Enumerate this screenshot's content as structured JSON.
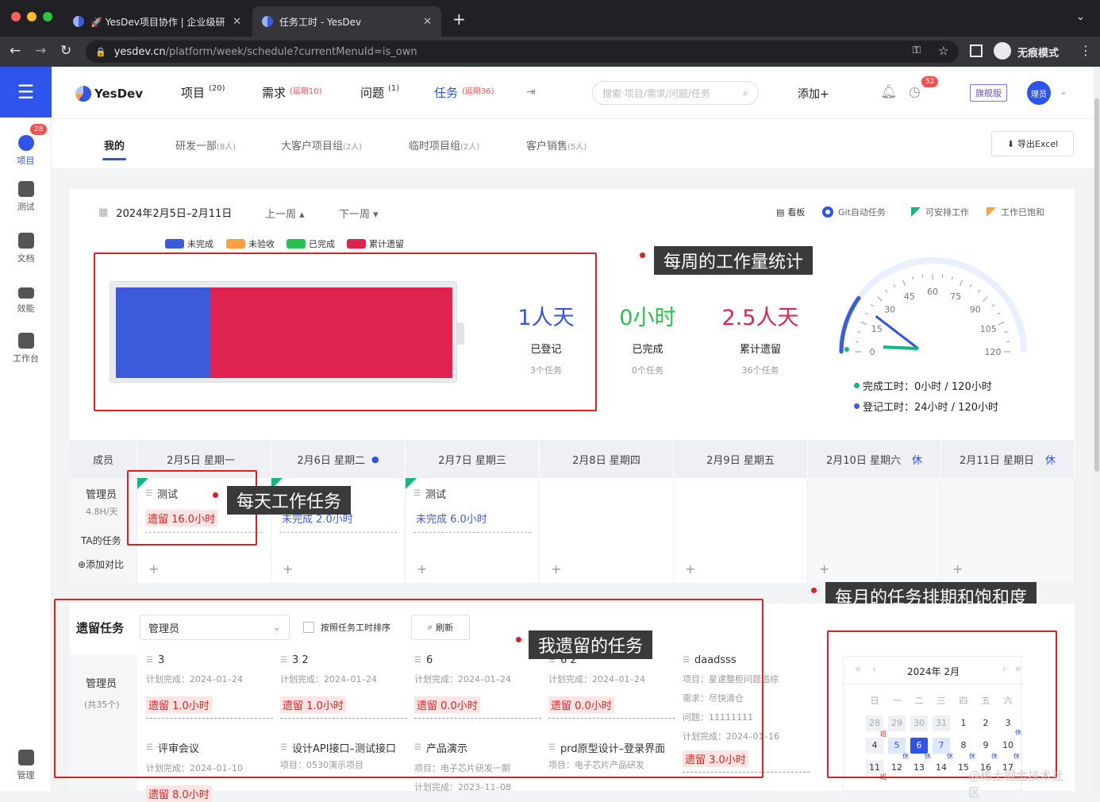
{
  "browser": {
    "tabs": [
      {
        "label": "🚀 YesDev项目协作 | 企业级研发"
      },
      {
        "label": "任务工时 - YesDev"
      }
    ],
    "url_host": "yesdev.cn",
    "url_path": "/platform/week/schedule?currentMenuId=is_own",
    "incognito_label": "无痕模式",
    "new_tab": "+"
  },
  "sidebar": {
    "items": [
      {
        "label": "项目",
        "badge": "28"
      },
      {
        "label": "测试"
      },
      {
        "label": "文档"
      },
      {
        "label": "效能"
      },
      {
        "label": "工作台"
      }
    ],
    "bottom": {
      "label": "管理"
    }
  },
  "header": {
    "logo": "YesDev",
    "nav": [
      {
        "label": "项目",
        "sup": "(20)"
      },
      {
        "label": "需求",
        "sup": "(延期10)"
      },
      {
        "label": "问题",
        "sup": "(1)"
      },
      {
        "label": "任务",
        "sup": "(延期36)"
      }
    ],
    "search_placeholder": "搜索 项目/需求/问题/任务",
    "add": "添加+",
    "notif_badge": "52",
    "edition": "旗舰版",
    "avatar": "理员"
  },
  "subnav": {
    "tabs": [
      {
        "label": "我的",
        "count": ""
      },
      {
        "label": "研发一部",
        "count": "(8人)"
      },
      {
        "label": "大客户项目组",
        "count": "(2人)"
      },
      {
        "label": "临时项目组",
        "count": "(2人)"
      },
      {
        "label": "客户销售",
        "count": "(5人)"
      }
    ],
    "export": "导出Excel"
  },
  "week": {
    "range": "2024年2月5日–2月11日",
    "prev": "上一周",
    "next": "下一周",
    "tools": [
      "看板",
      "Git自动任务",
      "可安排工作",
      "工作已饱和"
    ],
    "legend": [
      {
        "label": "未完成",
        "color": "#3b5bdb"
      },
      {
        "label": "未验收",
        "color": "#ff9f43"
      },
      {
        "label": "已完成",
        "color": "#27c24c"
      },
      {
        "label": "累计遗留",
        "color": "#e0234e"
      }
    ],
    "battery_fraction": {
      "incomplete": 0.28,
      "remain": 0.72
    },
    "stats": [
      {
        "value": "1人天",
        "label": "已登记",
        "sub": "3个任务",
        "color": "#2f54eb"
      },
      {
        "value": "0小时",
        "label": "已完成",
        "sub": "0个任务",
        "color": "#27c24c"
      },
      {
        "value": "2.5人天",
        "label": "累计遗留",
        "sub": "36个任务",
        "color": "#e0234e"
      }
    ],
    "gauge": {
      "ticks": [
        "0",
        "15",
        "30",
        "45",
        "60",
        "75",
        "90",
        "105",
        "120"
      ],
      "needle_value": 24,
      "max": 120
    },
    "gauge_legend": [
      {
        "label": "完成工时：0小时 / 120小时",
        "color": "#10b981"
      },
      {
        "label": "登记工时：24小时 / 120小时",
        "color": "#3b5bdb"
      }
    ],
    "callout": "每周的工作量统计"
  },
  "schedule": {
    "member_header": "成员",
    "days": [
      {
        "label": "2月5日 星期一",
        "tag": ""
      },
      {
        "label": "2月6日 星期二",
        "tag": "●"
      },
      {
        "label": "2月7日 星期三",
        "tag": ""
      },
      {
        "label": "2月8日 星期四",
        "tag": ""
      },
      {
        "label": "2月9日 星期五",
        "tag": ""
      },
      {
        "label": "2月10日 星期六",
        "tag": "休"
      },
      {
        "label": "2月11日 星期日",
        "tag": "休"
      }
    ],
    "member": {
      "name": "管理员",
      "rate": "4.8H/天",
      "ta": "TA的任务",
      "compare": "⊕添加对比"
    },
    "tasks": [
      {
        "day": 0,
        "title": "测试",
        "status": "遗留 16.0小时",
        "kind": "red"
      },
      {
        "day": 1,
        "title": "测试",
        "status": "未完成 2.0小时",
        "kind": "blue"
      },
      {
        "day": 2,
        "title": "测试",
        "status": "未完成 6.0小时",
        "kind": "blue"
      }
    ],
    "callout_daily": "每天工作任务",
    "callout_month": "每月的任务排期和饱和度"
  },
  "remain": {
    "title": "遗留任务",
    "member_select": "管理员",
    "sort_label": "按照任务工时排序",
    "refresh": "刷新",
    "callout": "我遗留的任务",
    "member": {
      "name": "管理员",
      "count": "(共35个)"
    },
    "cards": [
      {
        "title": "3",
        "lines": [
          "计划完成：2024–01–24"
        ],
        "status": "遗留 1.0小时"
      },
      {
        "title": "3 2",
        "lines": [
          "计划完成：2024–01–24"
        ],
        "status": "遗留 1.0小时"
      },
      {
        "title": "6",
        "lines": [
          "计划完成：2024–01–24"
        ],
        "status": "遗留 0.0小时"
      },
      {
        "title": "6 2",
        "lines": [
          "计划完成：2024–01–24"
        ],
        "status": "遗留 0.0小时"
      },
      {
        "title": "daadsss",
        "lines": [
          "项目：星速整柜问题追综",
          "需求：尽快清仓",
          "问题：11111111",
          "计划完成：2024–01–16"
        ],
        "status": "遗留 3.0小时"
      }
    ],
    "cards_row2": [
      {
        "title": "评审会议",
        "line": "计划完成：2024–01–10",
        "status": "遗留 8.0小时"
      },
      {
        "title": "设计API接口–测试接口",
        "line": "项目：0530演示项目"
      },
      {
        "title": "产品演示",
        "line": "项目：电子芯片研发一期",
        "line2": "计划完成：2023–11–08"
      },
      {
        "title": "prd原型设计–登录界面",
        "line": "项目：电子芯片产品研发"
      }
    ]
  },
  "calendar": {
    "title": "2024年 2月",
    "weekdays": [
      "日",
      "一",
      "二",
      "三",
      "四",
      "五",
      "六"
    ],
    "row1": [
      "28",
      "29",
      "30",
      "31",
      "1",
      "2",
      "3"
    ],
    "row2": [
      "4",
      "5",
      "6",
      "7",
      "8",
      "9",
      "10"
    ],
    "row3": [
      "11",
      "12",
      "13",
      "14",
      "15",
      "16",
      "17"
    ],
    "tag_ban": "班",
    "tag_xiu": "休"
  },
  "watermark": "@稀土掘金技术社区"
}
